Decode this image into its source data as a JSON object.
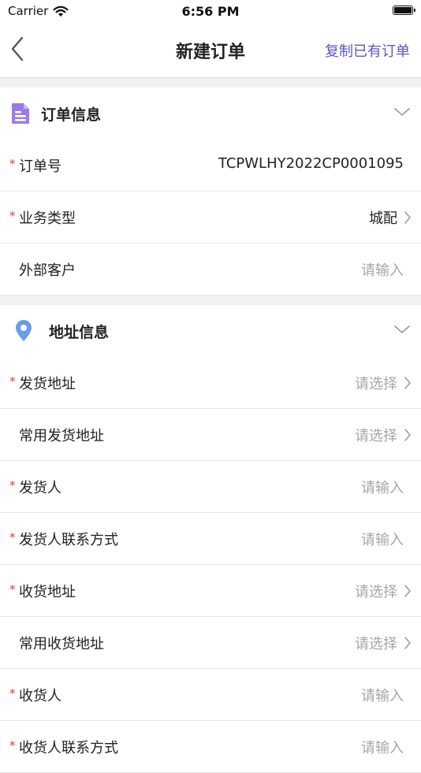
{
  "status": {
    "carrier": "Carrier",
    "time": "6:56 PM"
  },
  "nav": {
    "title": "新建订单",
    "action": "复制已有订单"
  },
  "order_section": {
    "title": "订单信息",
    "rows": [
      {
        "label": "订单号",
        "value": "TCPWLHY2022CP0001095"
      },
      {
        "label": "业务类型",
        "value": "城配"
      },
      {
        "label": "外部客户",
        "value": "请输入"
      }
    ]
  },
  "address_section": {
    "title": "地址信息",
    "rows": [
      {
        "label": " 发货地址",
        "value": "请选择"
      },
      {
        "label": "常用发货地址",
        "value": "请选择"
      },
      {
        "label": "发货人",
        "value": "请输入"
      },
      {
        "label": "发货人联系方式",
        "value": "请输入"
      },
      {
        "label": " 收货地址",
        "value": "请选择"
      },
      {
        "label": "常用收货地址",
        "value": "请选择"
      },
      {
        "label": "收货人",
        "value": "请输入"
      },
      {
        "label": "收货人联系方式",
        "value": "请输入"
      }
    ]
  },
  "required_mark": "*",
  "colors": {
    "accent": "#5b56c9",
    "required": "#e03a3a",
    "placeholder": "#a6a6a6",
    "doc_icon": "#9b7be8",
    "location_icon": "#6a9de8"
  }
}
